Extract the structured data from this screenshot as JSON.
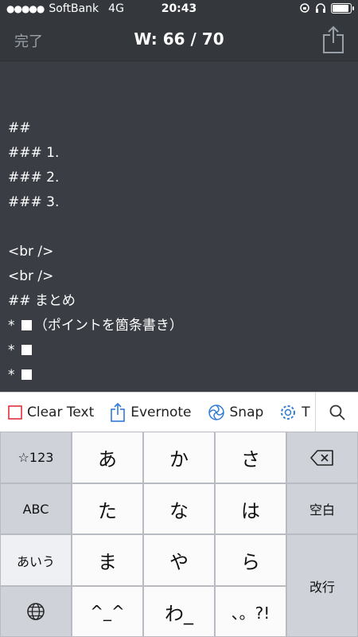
{
  "status_bar": {
    "signal_dots": "●●●●●",
    "carrier": "SoftBank",
    "network": "4G",
    "time": "20:43"
  },
  "nav": {
    "done_label": "完了",
    "word_count": "W: 66 / 70",
    "share_icon": "share-icon"
  },
  "editor": {
    "lines": [
      "##",
      "### 1.",
      "### 2.",
      "### 3.",
      "",
      "<br />",
      "<br />",
      "## まとめ"
    ],
    "bullet_prefix": "*",
    "bullets": [
      "（ポイントを箇条書き）",
      "",
      ""
    ]
  },
  "toolbar": {
    "items": [
      {
        "label": "Clear Text",
        "icon": "clear-square-icon"
      },
      {
        "label": "Evernote",
        "icon": "share-icon"
      },
      {
        "label": "Snap",
        "icon": "snap-swirl-icon"
      },
      {
        "label": "T",
        "icon": "gear-icon"
      }
    ],
    "search_icon": "search-icon"
  },
  "keyboard": {
    "left_keys": [
      "☆123",
      "ABC",
      "あいう"
    ],
    "globe_icon": "globe-icon",
    "rows": [
      [
        "あ",
        "か",
        "さ"
      ],
      [
        "た",
        "な",
        "は"
      ],
      [
        "ま",
        "や",
        "ら"
      ],
      [
        "^_^",
        "わ_",
        "、。?!"
      ]
    ],
    "delete_icon": "delete-backspace-icon",
    "space_label": "空白",
    "return_label": "改行"
  }
}
